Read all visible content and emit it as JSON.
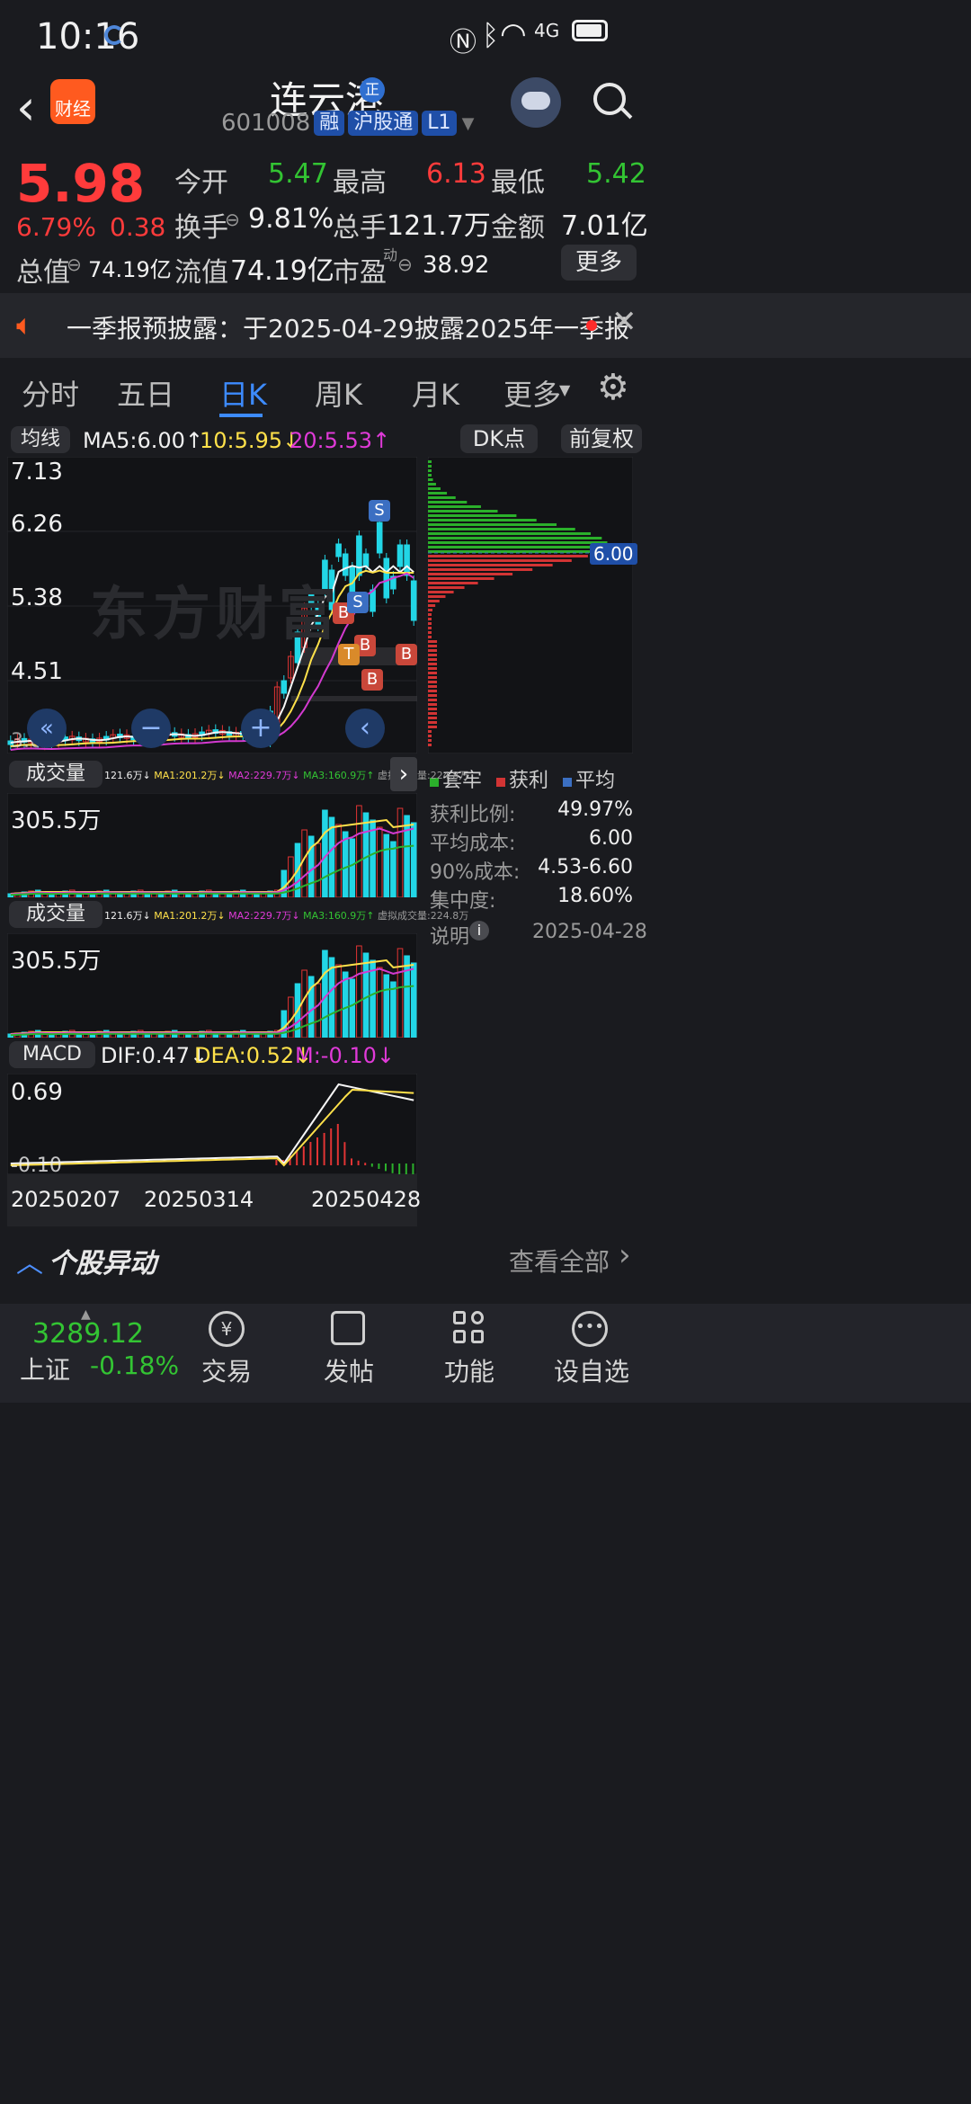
{
  "status_bar": {
    "time": "10:16",
    "network": "4G"
  },
  "header": {
    "title": "连云港",
    "badge": "正",
    "code": "601008",
    "tags": [
      "融",
      "沪股通",
      "L1"
    ],
    "logo_text": "财经"
  },
  "quote": {
    "price": "5.98",
    "change_pct": "6.79%",
    "change": "0.38",
    "open_label": "今开",
    "open": "5.47",
    "high_label": "最高",
    "high": "6.13",
    "low_label": "最低",
    "low": "5.42",
    "turnover_label": "换手",
    "turnover": "9.81%",
    "volume_label": "总手",
    "volume": "121.7万",
    "amount_label": "金额",
    "amount": "7.01亿",
    "mktcap_label": "总值",
    "mktcap": "74.19亿",
    "float_label": "流值",
    "float": "74.19亿",
    "pe_label": "市盈",
    "pe_sup": "动",
    "pe": "38.92",
    "more_label": "更多"
  },
  "notice": {
    "text": "一季报预披露：于2025-04-29披露2025年一季报"
  },
  "tabs": [
    {
      "label": "分时",
      "active": false
    },
    {
      "label": "五日",
      "active": false
    },
    {
      "label": "日K",
      "active": true
    },
    {
      "label": "周K",
      "active": false
    },
    {
      "label": "月K",
      "active": false
    },
    {
      "label": "更多",
      "active": false
    }
  ],
  "ma_bar": {
    "selector": "均线",
    "ma5": "MA5:6.00↑",
    "ma10": "10:5.95↓",
    "ma20": "20:5.53↑",
    "dk_label": "DK点",
    "adjust_label": "前复权"
  },
  "kline": {
    "price_ticks": [
      "7.13",
      "6.26",
      "5.38",
      "4.51",
      "3.63"
    ],
    "watermark": "东方财富",
    "markers": [
      "B",
      "S",
      "S",
      "B",
      "T",
      "B",
      "B",
      "B"
    ]
  },
  "chip": {
    "current_price": "6.00",
    "legend": [
      "套牢",
      "获利",
      "平均"
    ],
    "stats": [
      {
        "label": "获利比例:",
        "value": "49.97%"
      },
      {
        "label": "平均成本:",
        "value": "6.00"
      },
      {
        "label": "90%成本:",
        "value": "4.53-6.60"
      },
      {
        "label": "集中度:",
        "value": "18.60%"
      }
    ],
    "note_label": "说明",
    "date": "2025-04-28"
  },
  "volume_panels": [
    {
      "selector": "成交量",
      "stats": "121.6万↓",
      "ma1": "MA1:201.2万↓",
      "ma2": "MA2:229.7万↓",
      "ma3": "MA3:160.9万↑",
      "virtual": "虚拟成交量:224.8万",
      "max": "305.5万"
    },
    {
      "selector": "成交量",
      "stats": "121.6万↓",
      "ma1": "MA1:201.2万↓",
      "ma2": "MA2:229.7万↓",
      "ma3": "MA3:160.9万↑",
      "virtual": "虚拟成交量:224.8万",
      "max": "305.5万"
    }
  ],
  "macd": {
    "selector": "MACD",
    "dif": "DIF:0.47↓",
    "dea": "DEA:0.52↓",
    "m": "M:-0.10↓",
    "ticks": [
      "0.69",
      "-0.10"
    ]
  },
  "dates": [
    "20250207",
    "20250314",
    "20250428"
  ],
  "movement": {
    "title": "个股异动",
    "view_all": "查看全部"
  },
  "bottom_nav": {
    "index_value": "3289.12",
    "index_name": "上证",
    "index_change": "-0.18%",
    "items": [
      "交易",
      "发帖",
      "功能",
      "设自选"
    ]
  }
}
